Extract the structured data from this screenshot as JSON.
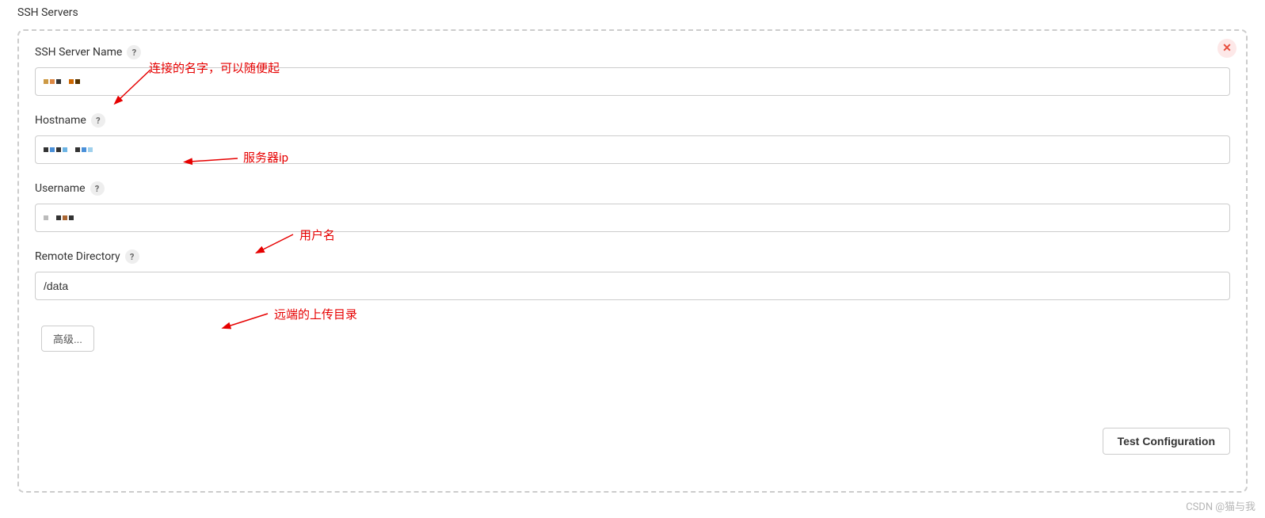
{
  "section": {
    "title": "SSH Servers"
  },
  "form": {
    "name_field": {
      "label": "SSH Server Name",
      "annotation": "连接的名字，可以随便起"
    },
    "hostname_field": {
      "label": "Hostname",
      "annotation": "服务器ip"
    },
    "username_field": {
      "label": "Username",
      "annotation": "用户名"
    },
    "remote_dir_field": {
      "label": "Remote Directory",
      "value": "/data",
      "annotation": "远端的上传目录"
    }
  },
  "buttons": {
    "advanced": "高级...",
    "test_config": "Test Configuration"
  },
  "help_icon": "?",
  "close_icon": "✕",
  "watermark": "CSDN @猫与我"
}
